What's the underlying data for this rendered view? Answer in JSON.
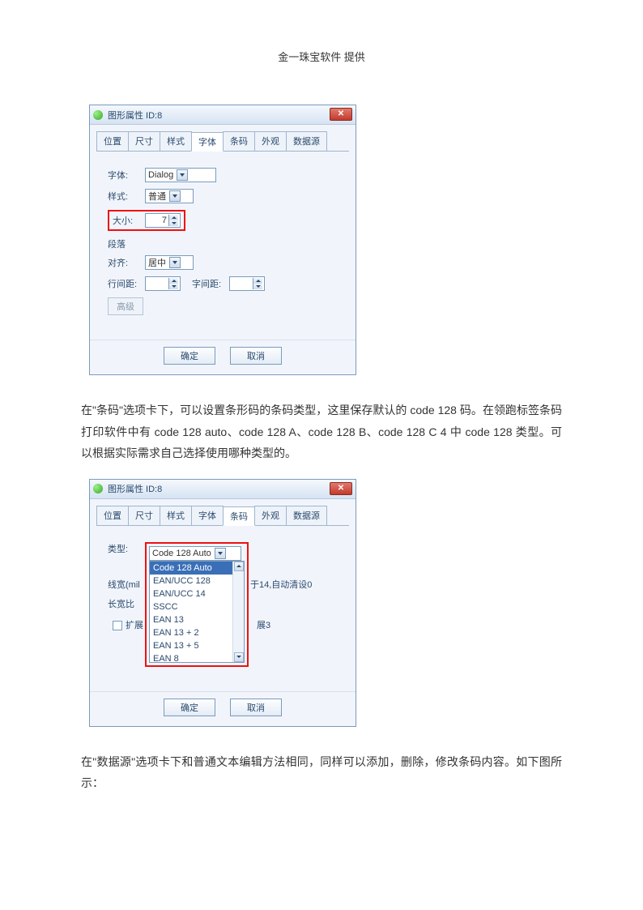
{
  "header": "金一珠宝软件 提供",
  "dialog1": {
    "title": "图形属性 ID:8",
    "tabs": [
      "位置",
      "尺寸",
      "样式",
      "字体",
      "条码",
      "外观",
      "数据源"
    ],
    "activeTab": 3,
    "font_label": "字体:",
    "font_value": "Dialog",
    "style_label": "样式:",
    "style_value": "普通",
    "size_label": "大小:",
    "size_value": "7",
    "para_group": "段落",
    "align_label": "对齐:",
    "align_value": "居中",
    "line_spacing_label": "行间距:",
    "line_spacing_value": "",
    "char_spacing_label": "字间距:",
    "char_spacing_value": "",
    "advanced": "高级",
    "ok": "确定",
    "cancel": "取消"
  },
  "para1": "在\"条码\"选项卡下，可以设置条形码的条码类型，这里保存默认的 code 128 码。在领跑标签条码打印软件中有 code 128 auto、code 128 A、code 128 B、code 128 C 4 中 code 128 类型。可以根据实际需求自己选择使用哪种类型的。",
  "dialog2": {
    "title": "图形属性 ID:8",
    "tabs": [
      "位置",
      "尺寸",
      "样式",
      "字体",
      "条码",
      "外观",
      "数据源"
    ],
    "activeTab": 4,
    "type_label": "类型:",
    "type_value": "Code 128 Auto",
    "options": [
      "Code 128 Auto",
      "EAN/UCC 128",
      "EAN/UCC 14",
      "SSCC",
      "EAN 13",
      "EAN 13 + 2",
      "EAN 13 + 5",
      "EAN 8"
    ],
    "linewidth_label": "线宽(mil",
    "ratio_label": "长宽比",
    "autoclear_note": "于14,自动清设0",
    "expand_chk_label": "扩展",
    "expand_note": "展3",
    "ok": "确定",
    "cancel": "取消"
  },
  "para2": "在\"数据源\"选项卡下和普通文本编辑方法相同，同样可以添加，删除，修改条码内容。如下图所示："
}
